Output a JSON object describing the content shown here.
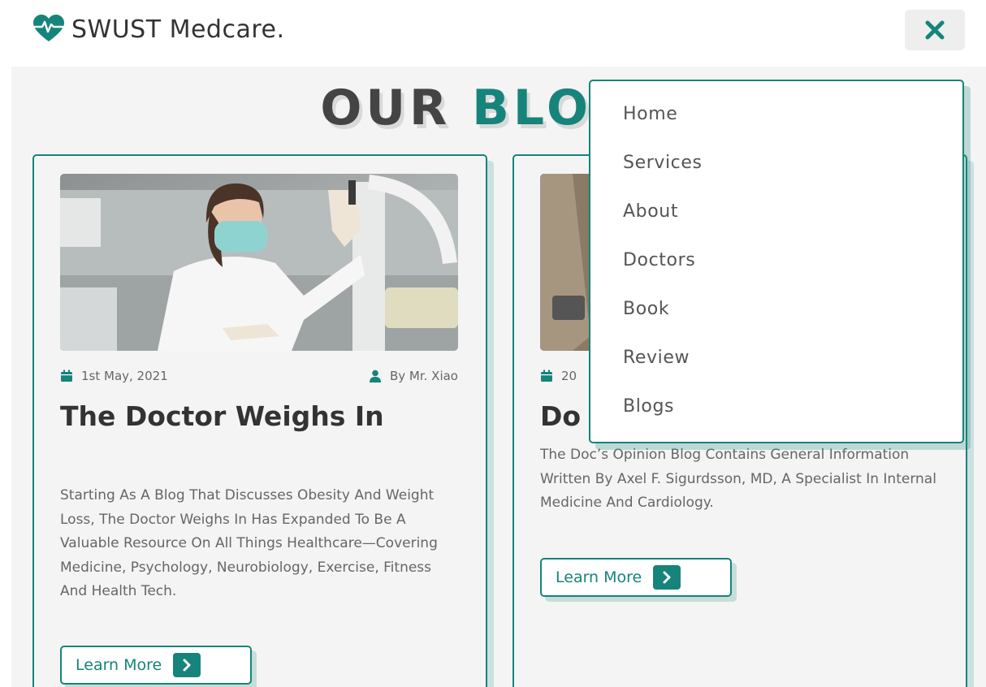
{
  "header": {
    "logo_text": "SWUST Medcare.",
    "logo_icon": "heartbeat-icon",
    "close_icon": "close-icon"
  },
  "heading": {
    "part1": "OUR",
    "part2": "BLO"
  },
  "colors": {
    "accent": "#16847a",
    "text_dark": "#333333",
    "text_muted": "#666666",
    "background": "#f4f4f4"
  },
  "cards": [
    {
      "image": "doctor-with-mask-photo",
      "date": "1st May, 2021",
      "author": "By Mr. Xiao",
      "title": "The Doctor Weighs In",
      "text": "Starting As A Blog That Discusses Obesity And Weight Loss, The Doctor Weighs In Has Expanded To Be A Valuable Resource On All Things Healthcare—Covering Medicine, Psychology, Neurobiology, Exercise, Fitness And Health Tech.",
      "button": "Learn More"
    },
    {
      "image": "doctor-office-photo",
      "date": "20",
      "title": "Do",
      "text": "The Doc’s Opinion Blog Contains General Information Written By Axel F. Sigurdsson, MD, A Specialist In Internal Medicine And Cardiology.",
      "button": "Learn More"
    }
  ],
  "menu": {
    "items": [
      "Home",
      "Services",
      "About",
      "Doctors",
      "Book",
      "Review",
      "Blogs"
    ]
  }
}
